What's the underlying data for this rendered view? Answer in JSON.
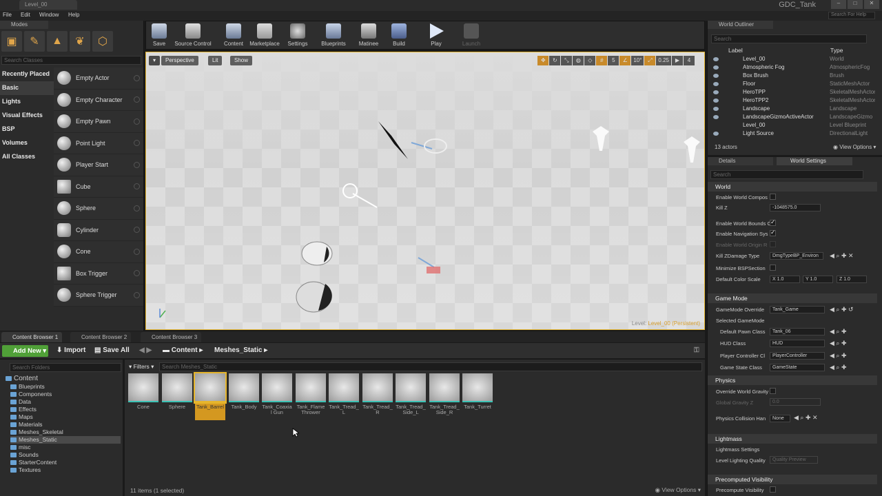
{
  "window": {
    "tab": "Level_00",
    "project": "GDC_Tank",
    "search_help": "Search For Help"
  },
  "menu": [
    "File",
    "Edit",
    "Window",
    "Help"
  ],
  "modes": {
    "title": "Modes",
    "search_placeholder": "Search Classes",
    "categories": [
      "Recently Placed",
      "Basic",
      "Lights",
      "Visual Effects",
      "BSP",
      "Volumes",
      "All Classes"
    ],
    "items": [
      "Empty Actor",
      "Empty Character",
      "Empty Pawn",
      "Point Light",
      "Player Start",
      "Cube",
      "Sphere",
      "Cylinder",
      "Cone",
      "Box Trigger",
      "Sphere Trigger"
    ]
  },
  "toolbar": {
    "buttons": [
      "Save",
      "Source Control",
      "Content",
      "Marketplace",
      "Settings",
      "Blueprints",
      "Matinee",
      "Build",
      "Play",
      "Launch"
    ]
  },
  "viewport": {
    "perspective": "Perspective",
    "lit": "Lit",
    "show": "Show",
    "grid_snap": "5",
    "rot_snap": "10°",
    "scale_snap": "0.25",
    "cam_speed": "4",
    "level_label": "Level:",
    "level_name": "Level_00 (Persistent)"
  },
  "content_browser": {
    "tabs": [
      "Content Browser 1",
      "Content Browser 2",
      "Content Browser 3"
    ],
    "add_new": "Add New",
    "import": "Import",
    "save_all": "Save All",
    "path": [
      "Content",
      "Meshes_Static"
    ],
    "search_folders": "Search Folders",
    "filters": "Filters",
    "search_assets": "Search Meshes_Static",
    "folders": {
      "root": "Content",
      "children": [
        "Blueprints",
        "Components",
        "Data",
        "Effects",
        "Maps",
        "Materials",
        "Meshes_Skeletal",
        "Meshes_Static",
        "misc",
        "Sounds",
        "StarterContent",
        "Textures"
      ]
    },
    "assets": [
      "Cone",
      "Sphere",
      "Tank_Barrel",
      "Tank_Body",
      "Tank_Coaxial Gun",
      "Tank_Flame Thrower",
      "Tank_Tread_L",
      "Tank_Tread_R",
      "Tank_Tread_Side_L",
      "Tank_Tread_Side_R",
      "Tank_Turret"
    ],
    "status": "11 items (1 selected)",
    "view_options": "View Options"
  },
  "outliner": {
    "title": "World Outliner",
    "search": "Search",
    "col_label": "Label",
    "col_type": "Type",
    "rows": [
      [
        "Level_00",
        "World"
      ],
      [
        "Atmospheric Fog",
        "AtmosphericFog"
      ],
      [
        "Box Brush",
        "Brush"
      ],
      [
        "Floor",
        "StaticMeshActor"
      ],
      [
        "HeroTPP",
        "SkeletalMeshActor"
      ],
      [
        "HeroTPP2",
        "SkeletalMeshActor"
      ],
      [
        "Landscape",
        "Landscape"
      ],
      [
        "LandscapeGizmoActiveActor",
        "LandscapeGizmo"
      ],
      [
        "Level_00",
        "Level Blueprint"
      ],
      [
        "Light Source",
        "DirectionalLight"
      ]
    ],
    "count": "13 actors",
    "view_options": "View Options"
  },
  "details": {
    "tab1": "Details",
    "tab2": "World Settings",
    "search": "Search",
    "world": {
      "title": "World",
      "enable_world_composition": "Enable World Compos",
      "kill_z": "Kill Z",
      "kill_z_value": "-1048575.0",
      "enable_world_bounds": "Enable World Bounds C",
      "enable_navigation": "Enable Navigation Sys",
      "enable_world_origin": "Enable World Origin R",
      "kill_zdamage": "Kill ZDamage Type",
      "kill_zdamage_value": "DmgTypeBP_Environ",
      "minimize_bsp": "Minimize BSPSection",
      "default_color_scale": "Default Color Scale",
      "x": "X 1.0",
      "y": "Y 1.0",
      "z": "Z 1.0"
    },
    "game_mode": {
      "title": "Game Mode",
      "override": "GameMode Override",
      "override_value": "Tank_Game",
      "selected": "Selected GameMode",
      "pawn": "Default Pawn Class",
      "pawn_value": "Tank_06",
      "hud": "HUD Class",
      "hud_value": "HUD",
      "pc": "Player Controller Cl",
      "pc_value": "PlayerController",
      "gs": "Game State Class",
      "gs_value": "GameState"
    },
    "physics": {
      "title": "Physics",
      "override_gravity": "Override World Gravity",
      "global_gravity": "Global Gravity Z",
      "global_gravity_value": "0.0",
      "collision": "Physics Collision Han",
      "collision_value": "None"
    },
    "lightmass": {
      "title": "Lightmass",
      "settings": "Lightmass Settings",
      "quality": "Level Lighting Quality",
      "quality_value": "Quality Preview"
    },
    "precomputed": {
      "title": "Precomputed Visibility",
      "label": "Precompute Visibility"
    }
  }
}
